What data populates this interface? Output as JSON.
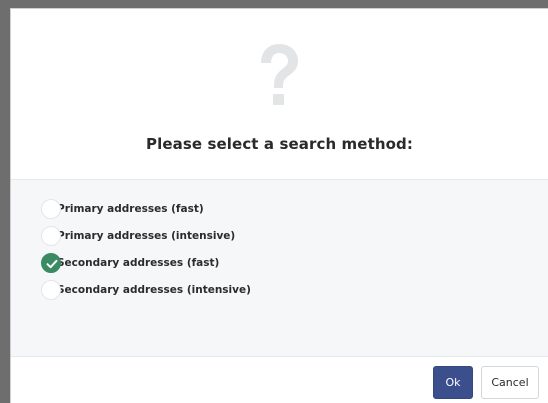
{
  "dialog": {
    "icon": "question-mark-icon",
    "title": "Please select a search method:",
    "options": [
      {
        "label": "Primary addresses (fast)",
        "selected": false
      },
      {
        "label": "Primary addresses (intensive)",
        "selected": false
      },
      {
        "label": "Secondary addresses (fast)",
        "selected": true
      },
      {
        "label": "Secondary addresses (intensive)",
        "selected": false
      }
    ],
    "buttons": {
      "ok_label": "Ok",
      "cancel_label": "Cancel"
    }
  },
  "colors": {
    "primary_button": "#3a4f8c",
    "selected_radio": "#3a8a63",
    "icon_gray": "#e3e4e6"
  }
}
